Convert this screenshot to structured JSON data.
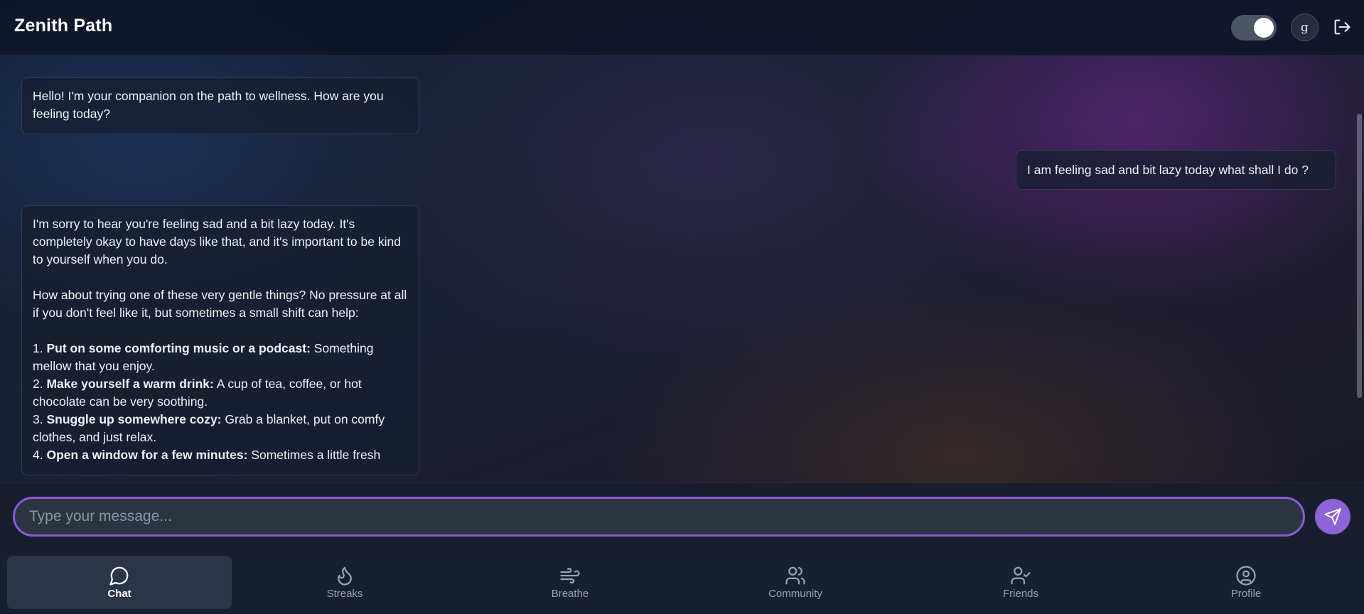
{
  "header": {
    "title": "Zenith Path",
    "avatar_initial": "g",
    "theme_toggle_on": true
  },
  "messages": [
    {
      "role": "assistant",
      "text": "Hello! I'm your companion on the path to wellness. How are you feeling today?"
    },
    {
      "role": "user",
      "text": "I am feeling sad and bit lazy today what shall I do ?"
    },
    {
      "role": "assistant",
      "paragraphs": [
        "I'm sorry to hear you're feeling sad and a bit lazy today. It's completely okay to have days like that, and it's important to be kind to yourself when you do.",
        "How about trying one of these very gentle things? No pressure at all if you don't feel like it, but sometimes a small shift can help:"
      ],
      "items": [
        {
          "num": "1.",
          "title": "Put on some comforting music or a podcast:",
          "text": "Something mellow that you enjoy."
        },
        {
          "num": "2.",
          "title": "Make yourself a warm drink:",
          "text": "A cup of tea, coffee, or hot chocolate can be very soothing."
        },
        {
          "num": "3.",
          "title": "Snuggle up somewhere cozy:",
          "text": "Grab a blanket, put on comfy clothes, and just relax."
        },
        {
          "num": "4.",
          "title": "Open a window for a few minutes:",
          "text": "Sometimes a little fresh"
        }
      ]
    }
  ],
  "composer": {
    "placeholder": "Type your message...",
    "value": ""
  },
  "nav": [
    {
      "label": "Chat",
      "icon": "chat-bubble-icon",
      "active": true
    },
    {
      "label": "Streaks",
      "icon": "flame-icon",
      "active": false
    },
    {
      "label": "Breathe",
      "icon": "wind-icon",
      "active": false
    },
    {
      "label": "Community",
      "icon": "users-icon",
      "active": false
    },
    {
      "label": "Friends",
      "icon": "user-check-icon",
      "active": false
    },
    {
      "label": "Profile",
      "icon": "user-circle-icon",
      "active": false
    }
  ],
  "colors": {
    "accent": "#8b5ad6",
    "send_button": "#8d63d8",
    "active_nav_bg": "#2a3547",
    "header_bg": "#10162a"
  }
}
